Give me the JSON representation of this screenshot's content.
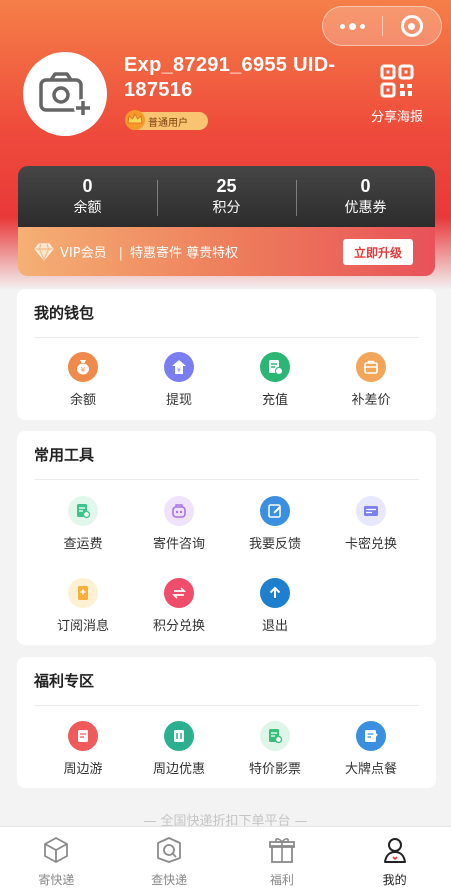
{
  "profile": {
    "username": "Exp_87291_6955 UID-187516",
    "badge": "普通用户",
    "share_label": "分享海报"
  },
  "stats": [
    {
      "value": "0",
      "label": "余额"
    },
    {
      "value": "25",
      "label": "积分"
    },
    {
      "value": "0",
      "label": "优惠券"
    }
  ],
  "vip": {
    "title": "VIP会员",
    "desc": "特惠寄件 尊贵特权",
    "button": "立即升级"
  },
  "wallet": {
    "title": "我的钱包",
    "items": [
      {
        "label": "余额",
        "icon": "money-bag-icon",
        "color": "#f08a4b"
      },
      {
        "label": "提现",
        "icon": "withdraw-icon",
        "color": "#7b7ef0"
      },
      {
        "label": "充值",
        "icon": "recharge-icon",
        "color": "#2bb673"
      },
      {
        "label": "补差价",
        "icon": "wallet-icon",
        "color": "#f3a65a"
      }
    ]
  },
  "tools": {
    "title": "常用工具",
    "items": [
      {
        "label": "查运费",
        "icon": "fee-search-icon",
        "color": "#3cc48a"
      },
      {
        "label": "寄件咨询",
        "icon": "robot-icon",
        "color": "#a673e6"
      },
      {
        "label": "我要反馈",
        "icon": "feedback-edit-icon",
        "color": "#3b8fe0"
      },
      {
        "label": "卡密兑换",
        "icon": "card-icon",
        "color": "#7c7ff0"
      },
      {
        "label": "订阅消息",
        "icon": "subscribe-icon",
        "color": "#f6b03b"
      },
      {
        "label": "积分兑换",
        "icon": "exchange-icon",
        "color": "#ef4d6a"
      },
      {
        "label": "退出",
        "icon": "logout-arrow-icon",
        "color": "#1e7fcf"
      }
    ]
  },
  "welfare": {
    "title": "福利专区",
    "items": [
      {
        "label": "周边游",
        "icon": "tour-icon",
        "color": "#ef5a5a"
      },
      {
        "label": "周边优惠",
        "icon": "discount-icon",
        "color": "#2bb08f"
      },
      {
        "label": "特价影票",
        "icon": "ticket-icon",
        "color": "#38bf7a"
      },
      {
        "label": "大牌点餐",
        "icon": "food-icon",
        "color": "#3b8fe0"
      }
    ]
  },
  "footer": {
    "slogan": "— 全国快递折扣下单平台 —"
  },
  "tabbar": [
    {
      "label": "寄快递",
      "icon": "parcel-icon"
    },
    {
      "label": "查快递",
      "icon": "track-icon"
    },
    {
      "label": "福利",
      "icon": "gift-icon"
    },
    {
      "label": "我的",
      "icon": "person-icon",
      "active": true
    }
  ]
}
